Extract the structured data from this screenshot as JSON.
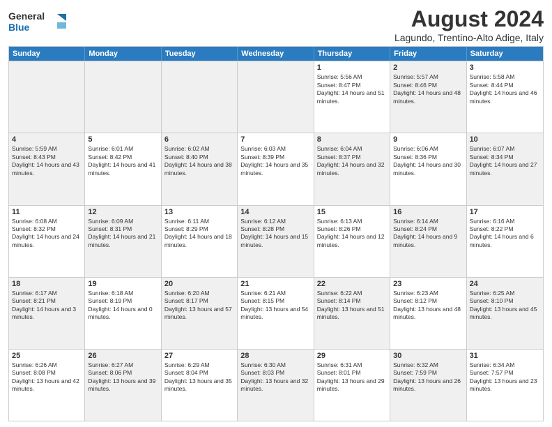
{
  "header": {
    "logo_general": "General",
    "logo_blue": "Blue",
    "month_year": "August 2024",
    "location": "Lagundo, Trentino-Alto Adige, Italy"
  },
  "days_of_week": [
    "Sunday",
    "Monday",
    "Tuesday",
    "Wednesday",
    "Thursday",
    "Friday",
    "Saturday"
  ],
  "weeks": [
    [
      {
        "day": "",
        "info": "",
        "shaded": true
      },
      {
        "day": "",
        "info": "",
        "shaded": true
      },
      {
        "day": "",
        "info": "",
        "shaded": true
      },
      {
        "day": "",
        "info": "",
        "shaded": true
      },
      {
        "day": "1",
        "info": "Sunrise: 5:56 AM\nSunset: 8:47 PM\nDaylight: 14 hours and 51 minutes."
      },
      {
        "day": "2",
        "info": "Sunrise: 5:57 AM\nSunset: 8:46 PM\nDaylight: 14 hours and 48 minutes.",
        "shaded": true
      },
      {
        "day": "3",
        "info": "Sunrise: 5:58 AM\nSunset: 8:44 PM\nDaylight: 14 hours and 46 minutes."
      }
    ],
    [
      {
        "day": "4",
        "info": "Sunrise: 5:59 AM\nSunset: 8:43 PM\nDaylight: 14 hours and 43 minutes.",
        "shaded": true
      },
      {
        "day": "5",
        "info": "Sunrise: 6:01 AM\nSunset: 8:42 PM\nDaylight: 14 hours and 41 minutes."
      },
      {
        "day": "6",
        "info": "Sunrise: 6:02 AM\nSunset: 8:40 PM\nDaylight: 14 hours and 38 minutes.",
        "shaded": true
      },
      {
        "day": "7",
        "info": "Sunrise: 6:03 AM\nSunset: 8:39 PM\nDaylight: 14 hours and 35 minutes."
      },
      {
        "day": "8",
        "info": "Sunrise: 6:04 AM\nSunset: 8:37 PM\nDaylight: 14 hours and 32 minutes.",
        "shaded": true
      },
      {
        "day": "9",
        "info": "Sunrise: 6:06 AM\nSunset: 8:36 PM\nDaylight: 14 hours and 30 minutes."
      },
      {
        "day": "10",
        "info": "Sunrise: 6:07 AM\nSunset: 8:34 PM\nDaylight: 14 hours and 27 minutes.",
        "shaded": true
      }
    ],
    [
      {
        "day": "11",
        "info": "Sunrise: 6:08 AM\nSunset: 8:32 PM\nDaylight: 14 hours and 24 minutes."
      },
      {
        "day": "12",
        "info": "Sunrise: 6:09 AM\nSunset: 8:31 PM\nDaylight: 14 hours and 21 minutes.",
        "shaded": true
      },
      {
        "day": "13",
        "info": "Sunrise: 6:11 AM\nSunset: 8:29 PM\nDaylight: 14 hours and 18 minutes."
      },
      {
        "day": "14",
        "info": "Sunrise: 6:12 AM\nSunset: 8:28 PM\nDaylight: 14 hours and 15 minutes.",
        "shaded": true
      },
      {
        "day": "15",
        "info": "Sunrise: 6:13 AM\nSunset: 8:26 PM\nDaylight: 14 hours and 12 minutes."
      },
      {
        "day": "16",
        "info": "Sunrise: 6:14 AM\nSunset: 8:24 PM\nDaylight: 14 hours and 9 minutes.",
        "shaded": true
      },
      {
        "day": "17",
        "info": "Sunrise: 6:16 AM\nSunset: 8:22 PM\nDaylight: 14 hours and 6 minutes."
      }
    ],
    [
      {
        "day": "18",
        "info": "Sunrise: 6:17 AM\nSunset: 8:21 PM\nDaylight: 14 hours and 3 minutes.",
        "shaded": true
      },
      {
        "day": "19",
        "info": "Sunrise: 6:18 AM\nSunset: 8:19 PM\nDaylight: 14 hours and 0 minutes."
      },
      {
        "day": "20",
        "info": "Sunrise: 6:20 AM\nSunset: 8:17 PM\nDaylight: 13 hours and 57 minutes.",
        "shaded": true
      },
      {
        "day": "21",
        "info": "Sunrise: 6:21 AM\nSunset: 8:15 PM\nDaylight: 13 hours and 54 minutes."
      },
      {
        "day": "22",
        "info": "Sunrise: 6:22 AM\nSunset: 8:14 PM\nDaylight: 13 hours and 51 minutes.",
        "shaded": true
      },
      {
        "day": "23",
        "info": "Sunrise: 6:23 AM\nSunset: 8:12 PM\nDaylight: 13 hours and 48 minutes."
      },
      {
        "day": "24",
        "info": "Sunrise: 6:25 AM\nSunset: 8:10 PM\nDaylight: 13 hours and 45 minutes.",
        "shaded": true
      }
    ],
    [
      {
        "day": "25",
        "info": "Sunrise: 6:26 AM\nSunset: 8:08 PM\nDaylight: 13 hours and 42 minutes."
      },
      {
        "day": "26",
        "info": "Sunrise: 6:27 AM\nSunset: 8:06 PM\nDaylight: 13 hours and 39 minutes.",
        "shaded": true
      },
      {
        "day": "27",
        "info": "Sunrise: 6:29 AM\nSunset: 8:04 PM\nDaylight: 13 hours and 35 minutes."
      },
      {
        "day": "28",
        "info": "Sunrise: 6:30 AM\nSunset: 8:03 PM\nDaylight: 13 hours and 32 minutes.",
        "shaded": true
      },
      {
        "day": "29",
        "info": "Sunrise: 6:31 AM\nSunset: 8:01 PM\nDaylight: 13 hours and 29 minutes."
      },
      {
        "day": "30",
        "info": "Sunrise: 6:32 AM\nSunset: 7:59 PM\nDaylight: 13 hours and 26 minutes.",
        "shaded": true
      },
      {
        "day": "31",
        "info": "Sunrise: 6:34 AM\nSunset: 7:57 PM\nDaylight: 13 hours and 23 minutes."
      }
    ]
  ]
}
